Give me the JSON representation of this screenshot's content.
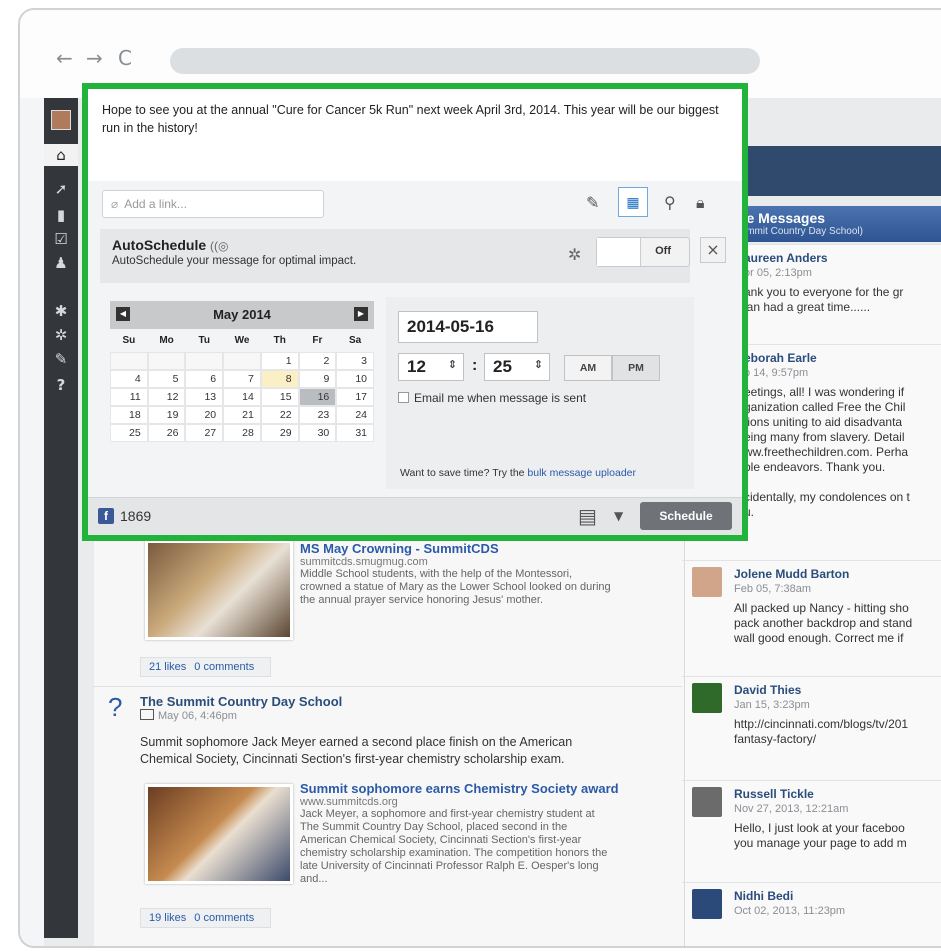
{
  "browser": {
    "back": "←",
    "forward": "→",
    "reload": "C"
  },
  "composer": {
    "message": "Hope to see you at the annual \"Cure for Cancer 5k Run\" next week April 3rd, 2014. This year will be our biggest run in the history!",
    "link_placeholder": "Add a link..."
  },
  "autoschedule": {
    "title": "AutoSchedule",
    "subtitle": "AutoSchedule your message for optimal impact.",
    "toggle": "Off",
    "close": "×"
  },
  "calendar": {
    "month": "May 2014",
    "days_of_week": [
      "Su",
      "Mo",
      "Tu",
      "We",
      "Th",
      "Fr",
      "Sa"
    ],
    "weeks": [
      [
        "",
        "",
        "",
        "",
        "1",
        "2",
        "3"
      ],
      [
        "4",
        "5",
        "6",
        "7",
        "8",
        "9",
        "10"
      ],
      [
        "11",
        "12",
        "13",
        "14",
        "15",
        "16",
        "17"
      ],
      [
        "18",
        "19",
        "20",
        "21",
        "22",
        "23",
        "24"
      ],
      [
        "25",
        "26",
        "27",
        "28",
        "29",
        "30",
        "31"
      ]
    ],
    "highlighted_day": "8",
    "selected_day": "16"
  },
  "scheduler": {
    "date": "2014-05-16",
    "hour": "12",
    "minute": "25",
    "am": "AM",
    "pm": "PM",
    "selected_period": "PM",
    "email_label": "Email me when message is sent",
    "bulk_prefix": "Want to save time? Try the ",
    "bulk_link": "bulk message uploader"
  },
  "footer": {
    "facebook_count": "1869",
    "schedule_label": "Schedule"
  },
  "private_messages": {
    "title": "ate Messages",
    "subtitle": "Summit Country Day School)",
    "items": [
      {
        "name": "aureen Anders",
        "time": "or 05, 2:13pm",
        "lines": [
          "ank you to everyone for the gr",
          "lan had a great time......"
        ]
      },
      {
        "name": "eborah Earle",
        "time": "b 14, 9:57pm",
        "lines": [
          "eetings, all! I was wondering if",
          "ganization called Free the Chil",
          "tions uniting to aid disadvanta",
          "eing many from slavery. Detail",
          "ww.freethechildren.com. Perha",
          "ble endeavors. Thank you.",
          "",
          "cidentally, my condolences on t",
          "u."
        ]
      },
      {
        "name": "Jolene Mudd Barton",
        "time": "Feb 05, 7:38am",
        "lines": [
          "All packed up Nancy - hitting sho",
          "pack another backdrop and stand",
          "wall good enough. Correct me if"
        ]
      },
      {
        "name": "David Thies",
        "time": "Jan 15, 3:23pm",
        "lines": [
          "http://cincinnati.com/blogs/tv/201",
          "fantasy-factory/"
        ]
      },
      {
        "name": "Russell Tickle",
        "time": "Nov 27, 2013, 12:21am",
        "lines": [
          "Hello, I just look at your faceboo",
          "you manage your page to add m"
        ]
      },
      {
        "name": "Nidhi Bedi",
        "time": "Oct 02, 2013, 11:23pm",
        "lines": []
      }
    ]
  },
  "feed": {
    "preview1": {
      "title": "MS May Crowning - SummitCDS",
      "url": "summitcds.smugmug.com",
      "desc": [
        "Middle School students, with the help of the Montessori,",
        "crowned a statue of Mary as the Lower School looked on during",
        "the annual prayer service honoring Jesus' mother."
      ],
      "likes": "21 likes",
      "comments": "0 comments"
    },
    "post2": {
      "author": "The Summit Country Day School",
      "time": "May 06, 4:46pm",
      "body": [
        "Summit sophomore Jack Meyer earned a second place finish on the American",
        "Chemical Society, Cincinnati Section's first-year chemistry scholarship exam."
      ],
      "preview": {
        "title": "Summit sophomore earns Chemistry Society award",
        "url": "www.summitcds.org",
        "desc": [
          "Jack Meyer, a sophomore and first-year chemistry student at",
          "The Summit Country Day School, placed second in the",
          "American Chemical Society, Cincinnati Section's first-year",
          "chemistry scholarship examination. The competition honors the",
          "late University of Cincinnati Professor Ralph E. Oesper's long",
          "and..."
        ]
      },
      "likes": "19 likes",
      "comments": "0 comments"
    }
  },
  "colors": {
    "highlight_border": "#22b43a",
    "sidebar": "#33373b",
    "link": "#2b5aa8",
    "facebook": "#3b5998"
  }
}
